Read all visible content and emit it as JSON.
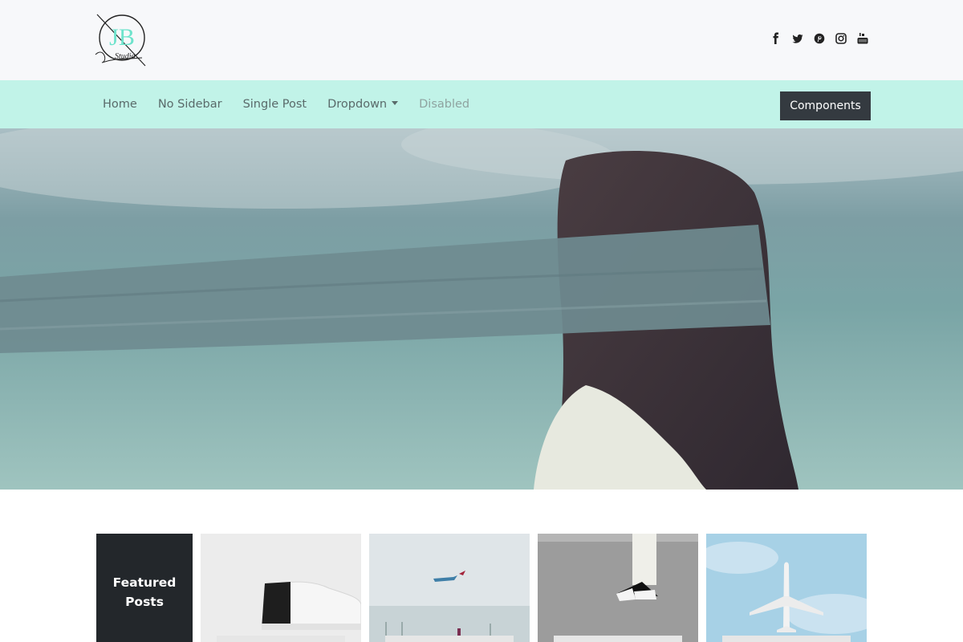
{
  "header": {
    "logo_alt": "JB Studio",
    "logo_letters": "JB",
    "logo_script": "Studio",
    "social_icons": [
      "facebook-icon",
      "twitter-icon",
      "pinterest-icon",
      "instagram-icon",
      "youtube-icon"
    ]
  },
  "nav": {
    "items": [
      {
        "label": "Home"
      },
      {
        "label": "No Sidebar"
      },
      {
        "label": "Single Post"
      },
      {
        "label": "Dropdown"
      },
      {
        "label": "Disabled"
      }
    ],
    "cta_label": "Components"
  },
  "featured": {
    "heading": "Featured Posts"
  },
  "colors": {
    "header_bg": "#f7f8fa",
    "nav_bg": "#c1f3e8",
    "accent": "#5fe0c8",
    "button_bg": "#343a40",
    "featured_bg": "#23272b"
  }
}
